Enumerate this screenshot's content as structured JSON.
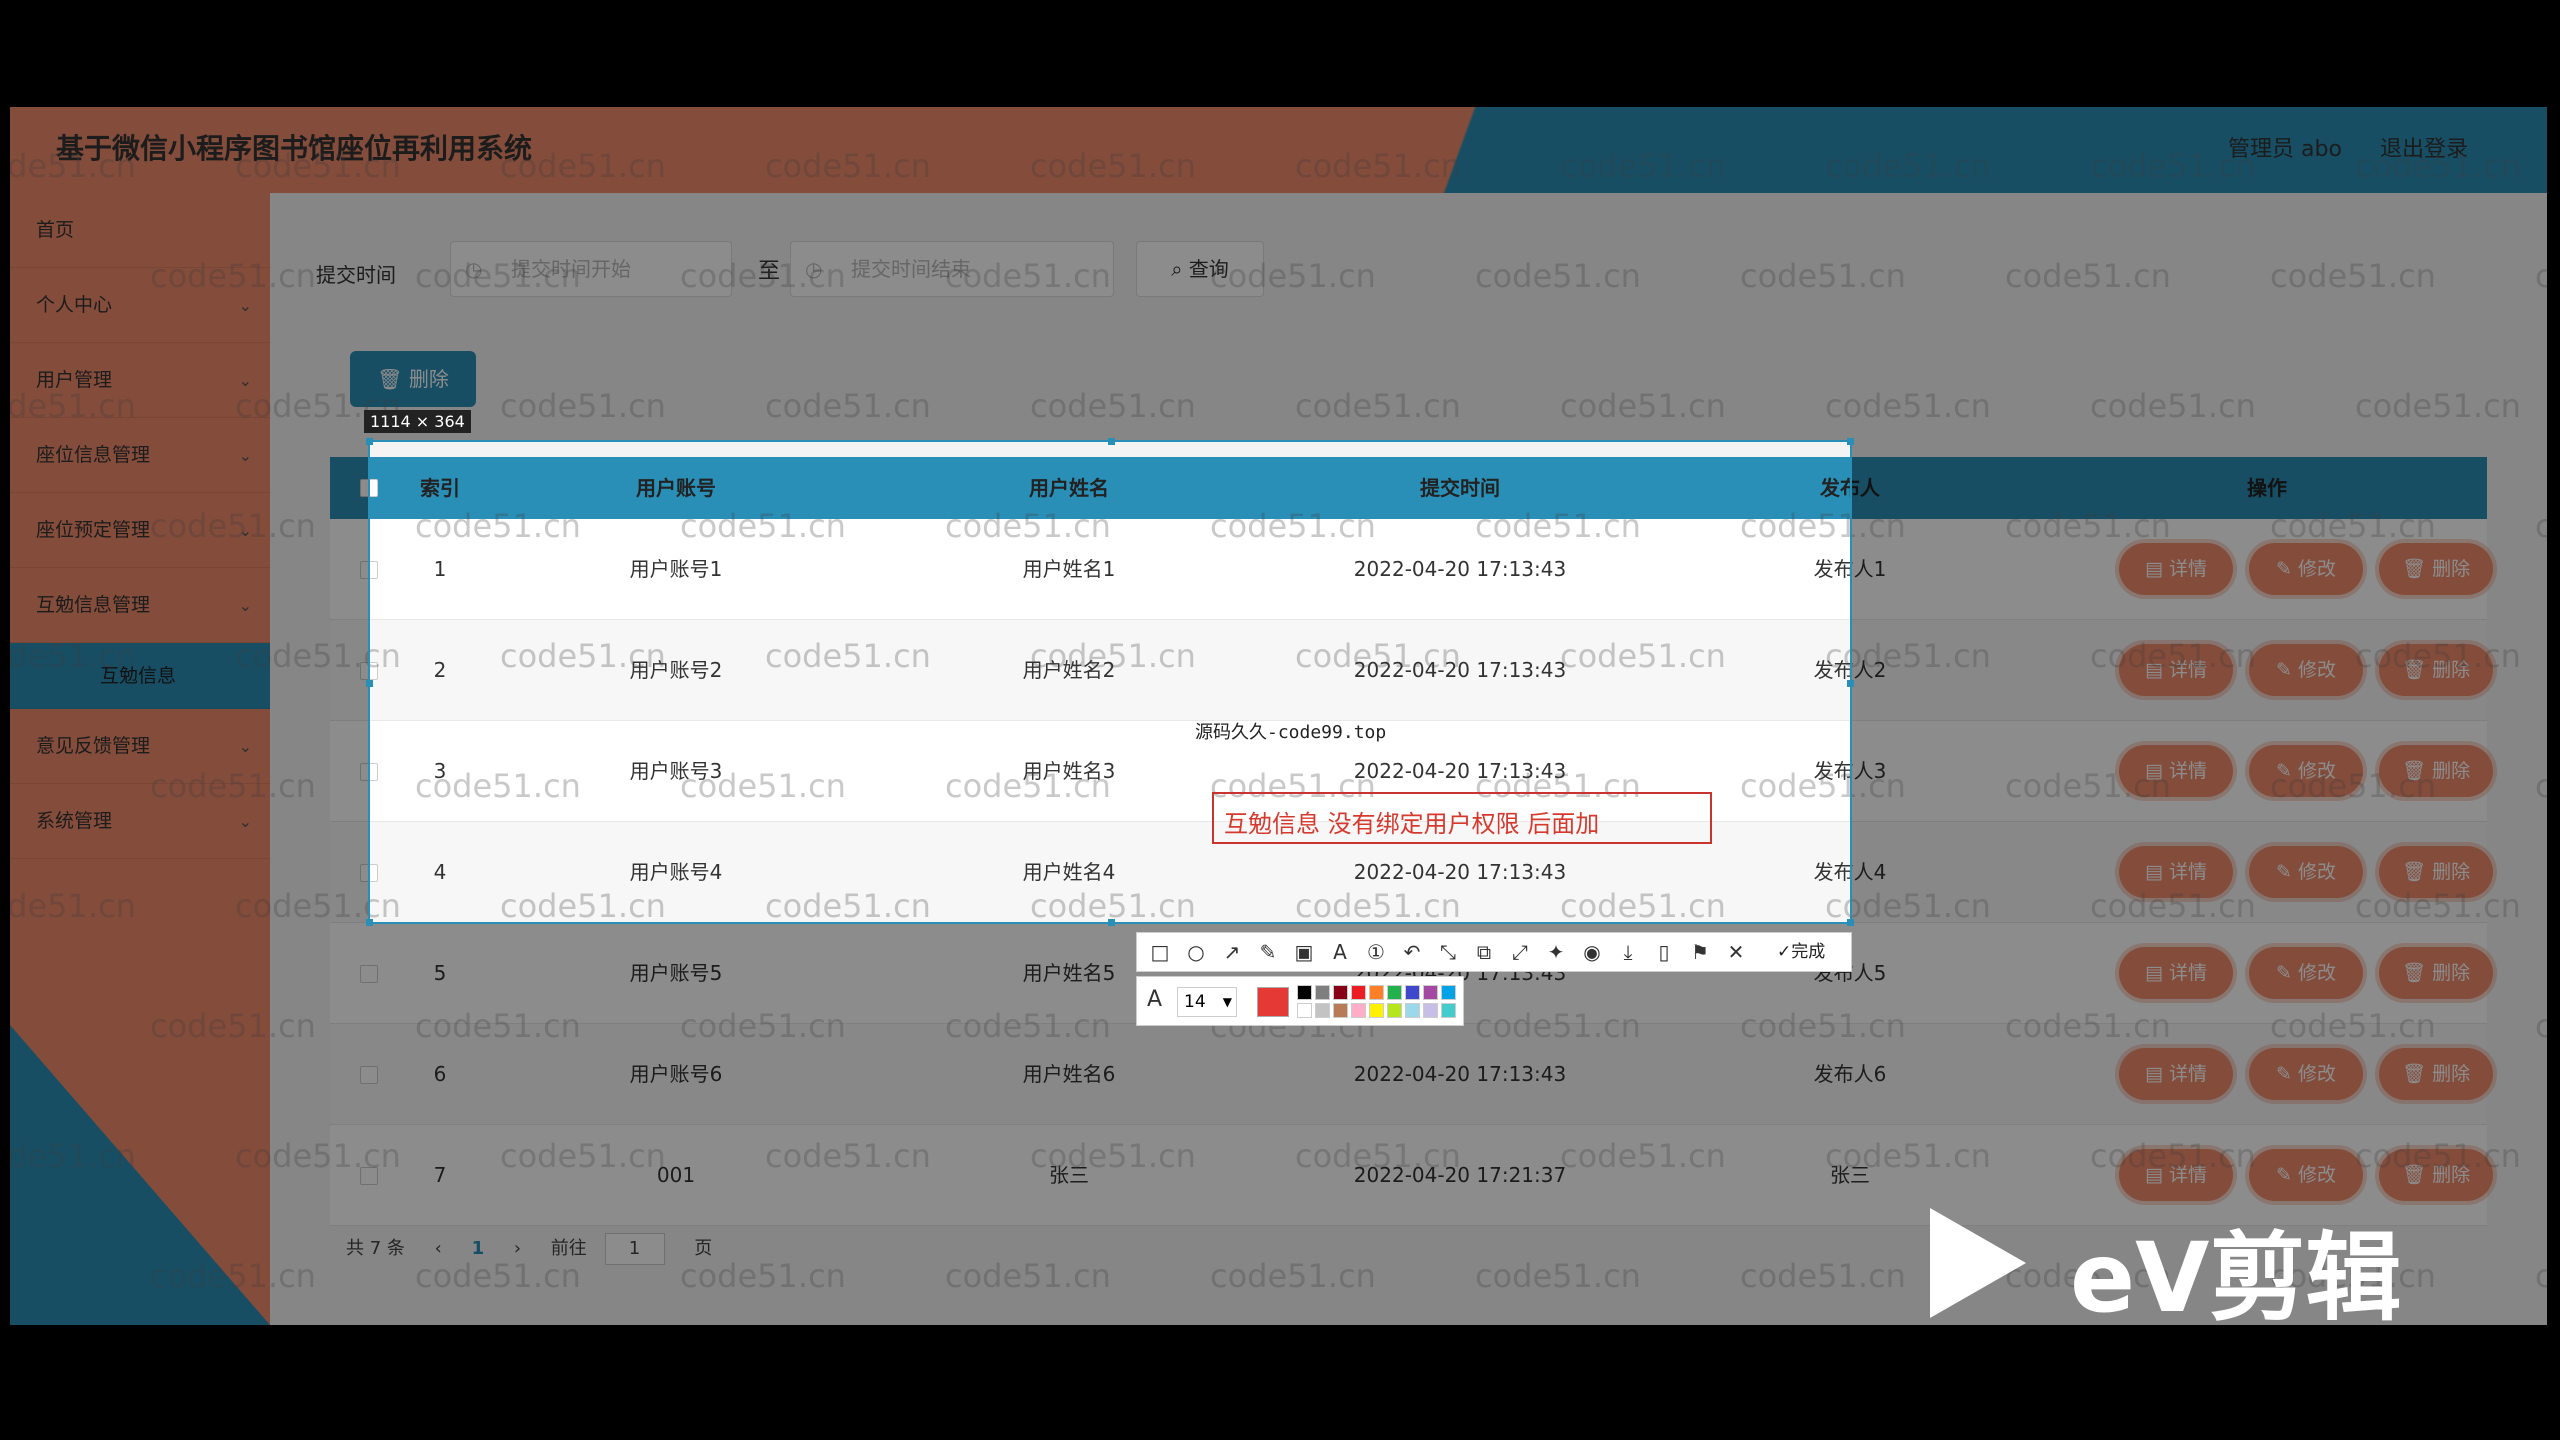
{
  "app": {
    "title": "基于微信小程序图书馆座位再利用系统",
    "admin": "管理员 abo",
    "logout": "退出登录"
  },
  "sidebar": {
    "items": [
      {
        "label": "首页",
        "chevron": ""
      },
      {
        "label": "个人中心",
        "chevron": "⌄"
      },
      {
        "label": "用户管理",
        "chevron": "⌄"
      },
      {
        "label": "座位信息管理",
        "chevron": "⌄"
      },
      {
        "label": "座位预定管理",
        "chevron": "⌄"
      },
      {
        "label": "互勉信息管理",
        "chevron": "⌄"
      },
      {
        "label": "互勉信息",
        "chevron": ""
      },
      {
        "label": "意见反馈管理",
        "chevron": "⌄"
      },
      {
        "label": "系统管理",
        "chevron": "⌄"
      }
    ]
  },
  "search": {
    "label": "提交时间",
    "start_placeholder": "提交时间开始",
    "to": "至",
    "end_placeholder": "提交时间结束",
    "query_button": "查询",
    "clock_icon": "◷",
    "search_icon": "⌕"
  },
  "toolbar": {
    "delete_label": "删除",
    "delete_icon": "🗑"
  },
  "table": {
    "columns": [
      "索引",
      "用户账号",
      "用户姓名",
      "提交时间",
      "发布人",
      "操作"
    ],
    "rows": [
      {
        "index": "1",
        "account": "用户账号1",
        "name": "用户姓名1",
        "time": "2022-04-20 17:13:43",
        "publisher": "发布人1"
      },
      {
        "index": "2",
        "account": "用户账号2",
        "name": "用户姓名2",
        "time": "2022-04-20 17:13:43",
        "publisher": "发布人2"
      },
      {
        "index": "3",
        "account": "用户账号3",
        "name": "用户姓名3",
        "time": "2022-04-20 17:13:43",
        "publisher": "发布人3"
      },
      {
        "index": "4",
        "account": "用户账号4",
        "name": "用户姓名4",
        "time": "2022-04-20 17:13:43",
        "publisher": "发布人4"
      },
      {
        "index": "5",
        "account": "用户账号5",
        "name": "用户姓名5",
        "time": "2022-04-20 17:13:43",
        "publisher": "发布人5"
      },
      {
        "index": "6",
        "account": "用户账号6",
        "name": "用户姓名6",
        "time": "2022-04-20 17:13:43",
        "publisher": "发布人6"
      },
      {
        "index": "7",
        "account": "001",
        "name": "张三",
        "time": "2022-04-20 17:21:37",
        "publisher": "张三"
      }
    ],
    "actions": {
      "detail": "详情",
      "edit": "修改",
      "delete": "删除"
    }
  },
  "pager": {
    "total": "共 7 条",
    "prev": "‹",
    "current": "1",
    "next": "›",
    "goto": "前往",
    "page_value": "1",
    "page_unit": "页"
  },
  "screenshot": {
    "size_label": "1114 × 364",
    "watermark_text": "源码久久-code99.top",
    "annotation": "互勉信息  没有绑定用户权限   后面加",
    "done": "完成",
    "font_size": "14",
    "tools": [
      "□",
      "○",
      "↗",
      "✎",
      "▣",
      "A",
      "①",
      "↶",
      "⤡",
      "⧉",
      "⤢",
      "✦",
      "◉",
      "⤓",
      "▯",
      "⚑",
      "✕"
    ],
    "colors": [
      "#000000",
      "#7f7f7f",
      "#880015",
      "#ed1c24",
      "#ff7f27",
      "#22b14c",
      "#3f48cc",
      "#a349a4",
      "#00a2e8",
      "#ffffff",
      "#c3c3c3",
      "#b97a57",
      "#ffaec9",
      "#fff200",
      "#b5e61d",
      "#99d9ea",
      "#c8bfe7",
      "#44cccc"
    ]
  },
  "watermark": "code51.cn",
  "ev_logo": "eV剪辑"
}
